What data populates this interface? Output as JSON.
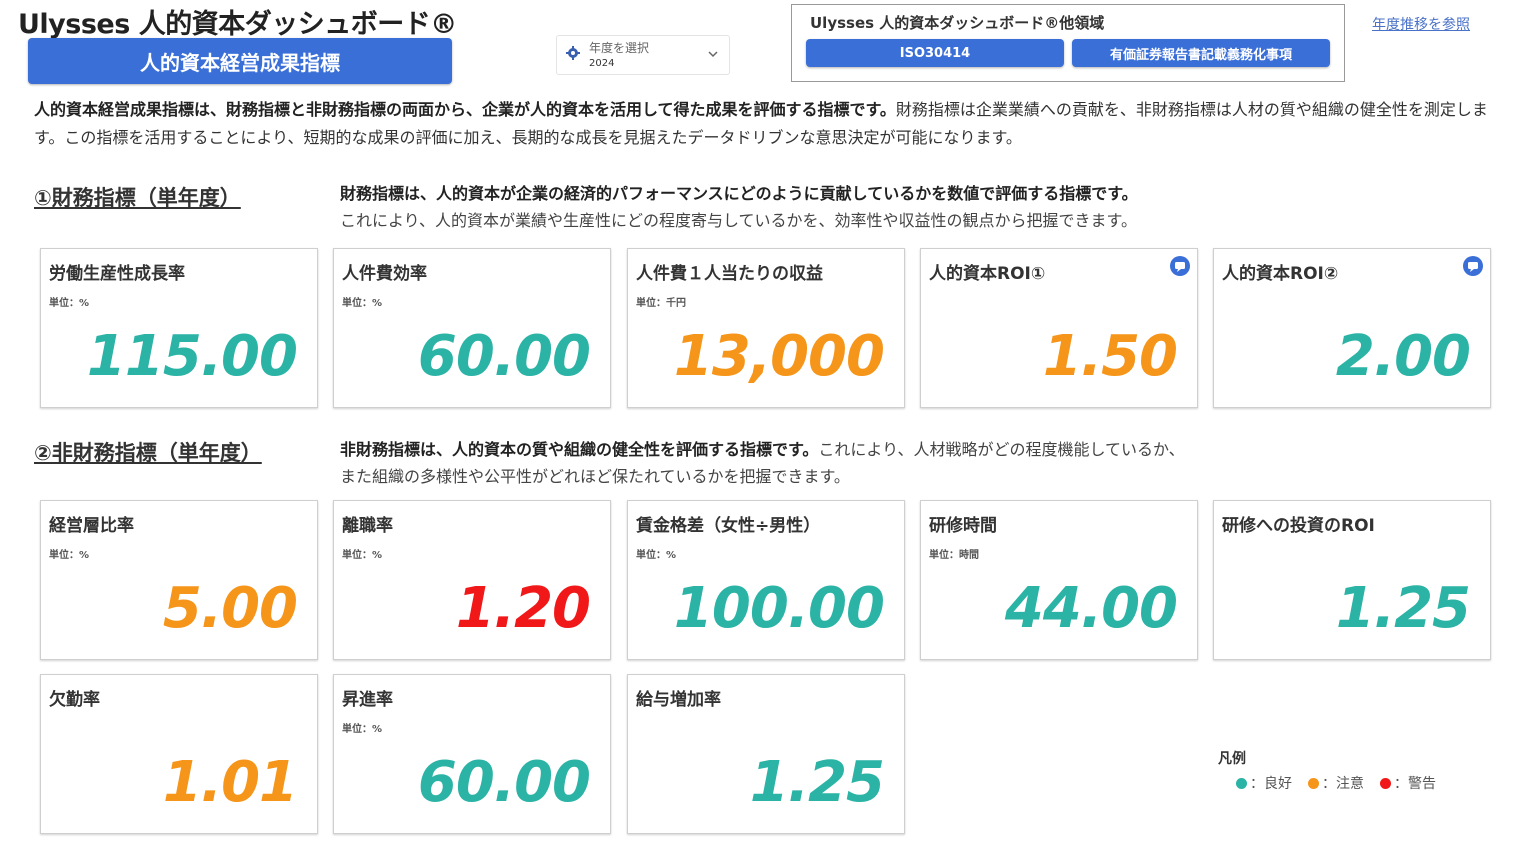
{
  "header": {
    "app_title": "Ulysses 人的資本ダッシュボード®",
    "main_tab_label": "人的資本経営成果指標",
    "year_select": {
      "label": "年度を選択",
      "value": "2024"
    },
    "other_domains": {
      "title": "Ulysses 人的資本ダッシュボード®他領域",
      "buttons": [
        "ISO30414",
        "有価証券報告書記載義務化事項"
      ]
    },
    "year_trend_link": "年度推移を参照"
  },
  "intro": {
    "bold": "人的資本経営成果指標は、財務指標と非財務指標の両面から、企業が人的資本を活用して得た成果を評価する指標です。",
    "text": "財務指標は企業業績への貢献を、非財務指標は人材の質や組織の健全性を測定します。この指標を活用することにより、短期的な成果の評価に加え、長期的な成長を見据えたデータドリブンな意思決定が可能になります。"
  },
  "financial": {
    "title": "①財務指標（単年度）",
    "desc_bold": "財務指標は、人的資本が企業の経済的パフォーマンスにどのように貢献しているかを数値で評価する指標です。",
    "desc_line2": "これにより、人的資本が業績や生産性にどの程度寄与しているかを、効率性や収益性の観点から把握できます。",
    "cards": [
      {
        "name": "労働生産性成長率",
        "unit": "単位：%",
        "value": "115.00",
        "status": "good",
        "info": false
      },
      {
        "name": "人件費効率",
        "unit": "単位：%",
        "value": "60.00",
        "status": "good",
        "info": false
      },
      {
        "name": "人件費１人当たりの収益",
        "unit": "単位：千円",
        "value": "13,000",
        "status": "caution",
        "info": false
      },
      {
        "name": "人的資本ROI①",
        "unit": "",
        "value": "1.50",
        "status": "caution",
        "info": true
      },
      {
        "name": "人的資本ROI②",
        "unit": "",
        "value": "2.00",
        "status": "good",
        "info": true
      }
    ]
  },
  "nonfinancial": {
    "title": "②非財務指標（単年度）",
    "desc_bold": "非財務指標は、人的資本の質や組織の健全性を評価する指標です。",
    "desc_rest": "これにより、人材戦略がどの程度機能しているか、",
    "desc_line2": "また組織の多様性や公平性がどれほど保たれているかを把握できます。",
    "cards": [
      {
        "name": "経営層比率",
        "unit": "単位：%",
        "value": "5.00",
        "status": "caution"
      },
      {
        "name": "離職率",
        "unit": "単位：%",
        "value": "1.20",
        "status": "warning"
      },
      {
        "name": "賃金格差（女性÷男性）",
        "unit": "単位：%",
        "value": "100.00",
        "status": "good"
      },
      {
        "name": "研修時間",
        "unit": "単位：時間",
        "value": "44.00",
        "status": "good"
      },
      {
        "name": "研修への投資のROI",
        "unit": "",
        "value": "1.25",
        "status": "good"
      },
      {
        "name": "欠勤率",
        "unit": "",
        "value": "1.01",
        "status": "caution"
      },
      {
        "name": "昇進率",
        "unit": "単位：%",
        "value": "60.00",
        "status": "good"
      },
      {
        "name": "給与増加率",
        "unit": "",
        "value": "1.25",
        "status": "good"
      }
    ]
  },
  "legend": {
    "title": "凡例",
    "items": [
      {
        "label": "：良好",
        "color": "#2bb3a6"
      },
      {
        "label": "：注意",
        "color": "#f5951a"
      },
      {
        "label": "：警告",
        "color": "#f01818"
      }
    ]
  },
  "icons": {
    "year_select": "gear-icon",
    "dropdown": "chevron-down-icon",
    "info": "chat-bubble-icon"
  }
}
